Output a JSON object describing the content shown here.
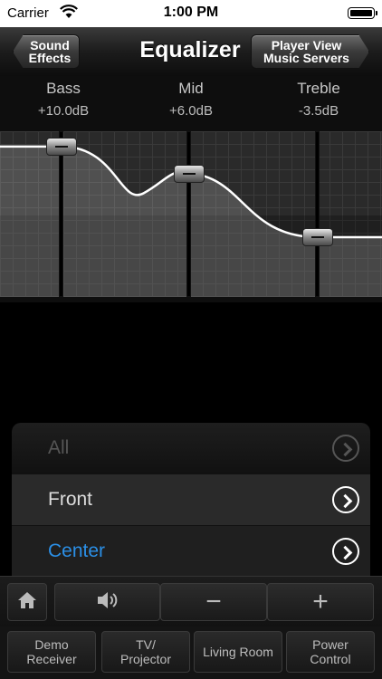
{
  "status_bar": {
    "carrier": "Carrier",
    "time": "1:00 PM"
  },
  "navbar": {
    "back_button": "Sound\nEffects",
    "title": "Equalizer",
    "forward_button": "Player View\nMusic Servers"
  },
  "equalizer": {
    "bands": [
      {
        "name": "Bass",
        "value": "+10.0dB",
        "db": 10.0
      },
      {
        "name": "Mid",
        "value": "+6.0dB",
        "db": 6.0
      },
      {
        "name": "Treble",
        "value": "-3.5dB",
        "db": -3.5
      }
    ]
  },
  "speaker_list": {
    "items": [
      {
        "label": "All",
        "state": "disabled"
      },
      {
        "label": "Front",
        "state": "normal"
      },
      {
        "label": "Center",
        "state": "selected"
      }
    ]
  },
  "toolbar": {
    "icons": [
      "home-icon",
      "speaker-icon"
    ],
    "minus_label": "−",
    "plus_label": "+"
  },
  "zones": [
    {
      "label": "Demo\nReceiver"
    },
    {
      "label": "TV/\nProjector"
    },
    {
      "label": "Living Room"
    },
    {
      "label": "Power\nControl"
    }
  ],
  "colors": {
    "selected_text": "#2b8fe6"
  }
}
